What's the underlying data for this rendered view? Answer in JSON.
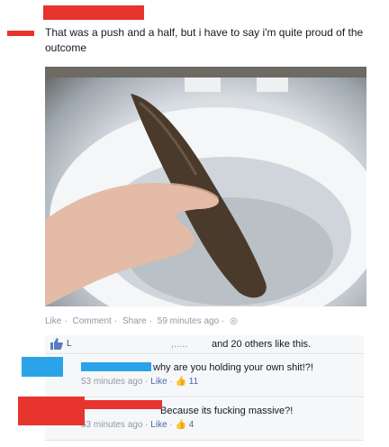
{
  "post": {
    "text": "That was a push and a half, but i have to say i'm quite proud of the outcome"
  },
  "actions": {
    "like": "Like",
    "comment": "Comment",
    "share": "Share",
    "time": "59 minutes ago",
    "audience_icon": "globe-icon"
  },
  "likes": {
    "count_visible": "L",
    "text": "and 20 others like this."
  },
  "comments": [
    {
      "text": "why are you holding your own shit!?!",
      "time": "53 minutes ago",
      "like_label": "Like",
      "like_count": "11"
    },
    {
      "text": "Because its fucking massive?!",
      "time": "53 minutes ago",
      "like_label": "Like",
      "like_count": "4"
    }
  ],
  "colors": {
    "redaction_red": "#e8342f",
    "redaction_blue": "#2aa3e8",
    "facebook_link": "#4b68a8",
    "muted_text": "#9197a3"
  }
}
